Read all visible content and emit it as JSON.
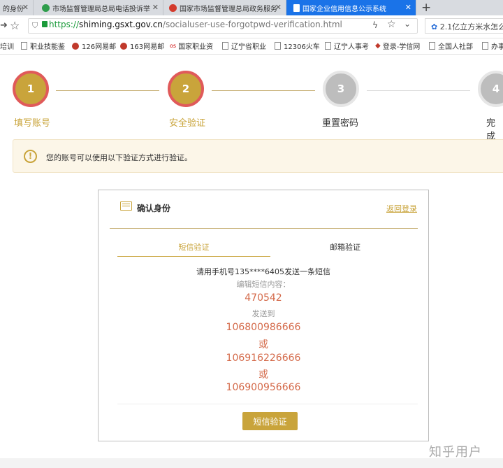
{
  "tabs": [
    {
      "title": "的身份"
    },
    {
      "title": "市场监督管理局总局电话投诉举"
    },
    {
      "title": "国家市场监督管理总局政务服务"
    },
    {
      "title": "国家企业信用信息公示系统",
      "active": true
    }
  ],
  "address": {
    "scheme": "https://",
    "host": "shiming.gsxt.gov.cn",
    "path": "/socialuser-use-forgotpwd-verification.html",
    "side_search": "2.1亿立方米水怎么"
  },
  "bookmarks": [
    "培训",
    "职业技能鉴",
    "126网易邮",
    "163网易邮",
    "国家职业资",
    "辽宁省职业",
    "12306火车",
    "辽宁人事考",
    "登录-学信网",
    "全国人社部",
    "办事"
  ],
  "steps": [
    {
      "num": "1",
      "label": "填写账号",
      "state": "done"
    },
    {
      "num": "2",
      "label": "安全验证",
      "state": "current"
    },
    {
      "num": "3",
      "label": "重置密码",
      "state": "todo"
    },
    {
      "num": "4",
      "label": "完成",
      "state": "todo"
    }
  ],
  "notice": {
    "text": "您的账号可以使用以下验证方式进行验证。"
  },
  "panel": {
    "title": "确认身份",
    "back_link": "返回登录",
    "tabs": {
      "sms": "短信验证",
      "email": "邮箱验证"
    },
    "instruction": "请用手机号135****6405发送一条短信",
    "content_label": "编辑短信内容：",
    "code": "470542",
    "send_to_label": "发送到",
    "numbers": [
      "106800986666",
      "106916226666",
      "106900956666"
    ],
    "or_text": "或",
    "submit": "短信验证"
  },
  "watermark": "知乎用户"
}
